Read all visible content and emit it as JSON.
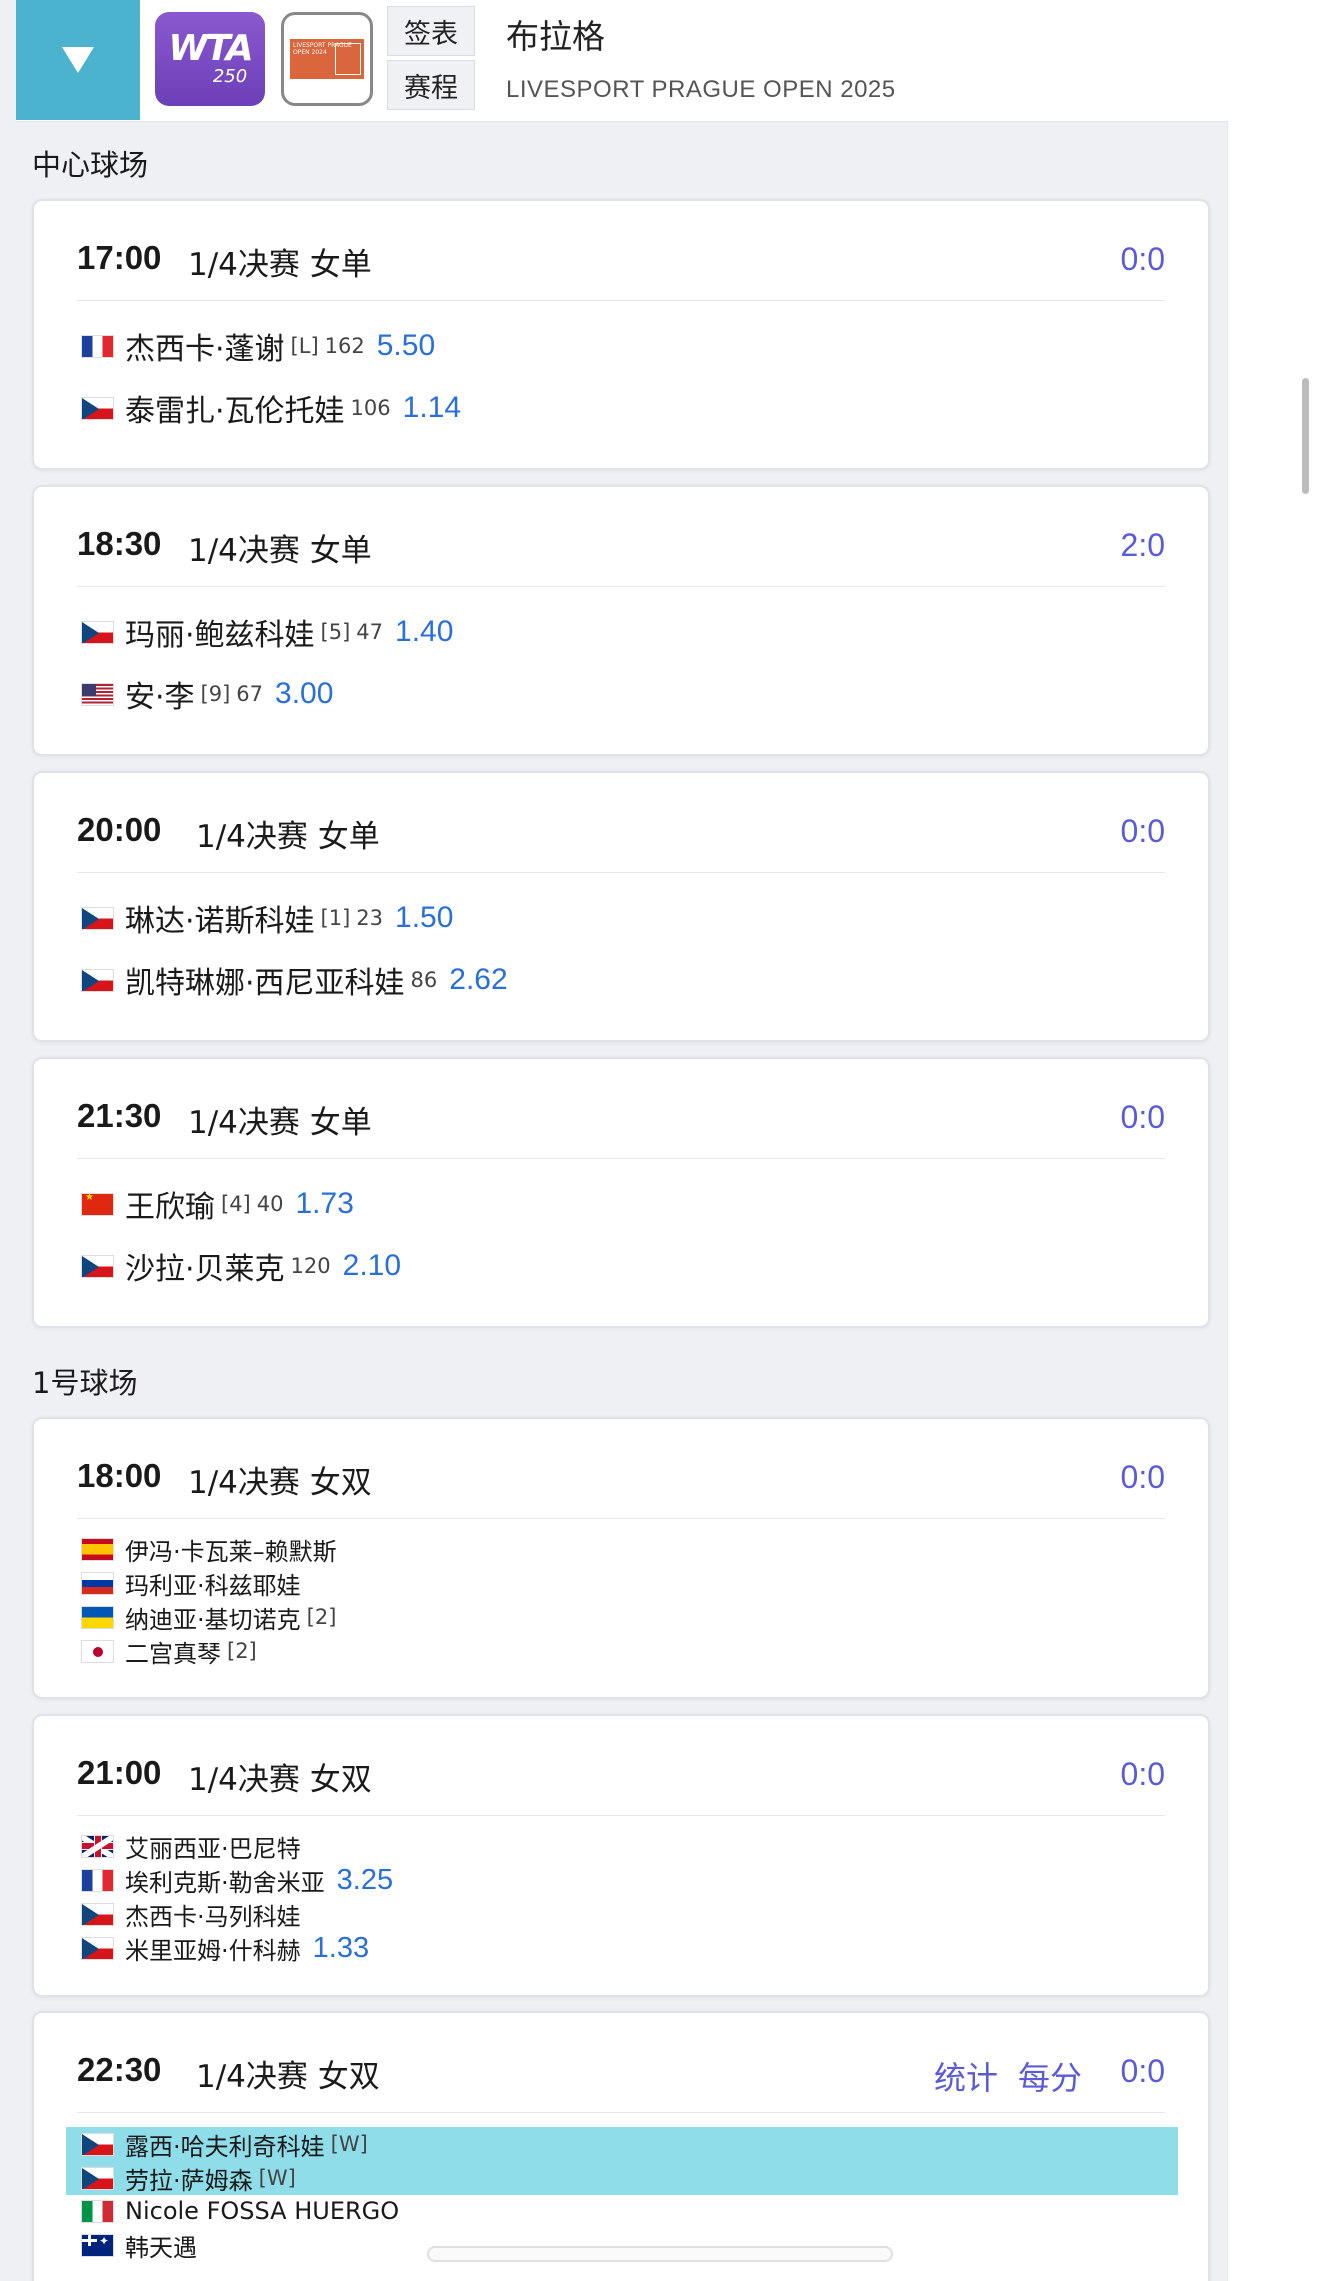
{
  "header": {
    "wta_brand": "WTA",
    "wta_tier": "250",
    "event_logo_text": "LIVESPORT PRAGUE OPEN 2024",
    "tab_draw": "签表",
    "tab_schedule": "赛程",
    "title": "布拉格",
    "subtitle": "LIVESPORT PRAGUE OPEN 2025"
  },
  "courts": [
    {
      "name": "中心球场",
      "matches": [
        {
          "time": "17:00",
          "round": "1/4决赛 女单",
          "score": "0:0",
          "players": [
            {
              "flag": "fr-flag-icon",
              "name": "杰西卡·蓬谢",
              "seed": "[L]",
              "rank": "162",
              "odds": "5.50"
            },
            {
              "flag": "cz-flag-icon",
              "name": "泰雷扎·瓦伦托娃",
              "seed": "",
              "rank": "106",
              "odds": "1.14"
            }
          ]
        },
        {
          "time": "18:30",
          "round": "1/4决赛 女单",
          "score": "2:0",
          "players": [
            {
              "flag": "cz-flag-icon",
              "name": "玛丽·鲍兹科娃",
              "seed": "[5]",
              "rank": "47",
              "odds": "1.40"
            },
            {
              "flag": "us-flag-icon",
              "name": "安·李",
              "seed": "[9]",
              "rank": "67",
              "odds": "3.00"
            }
          ]
        },
        {
          "time": "20:00",
          "round": "1/4决赛 女单",
          "score": "0:0",
          "players": [
            {
              "flag": "cz-flag-icon",
              "name": "琳达·诺斯科娃",
              "seed": "[1]",
              "rank": "23",
              "odds": "1.50"
            },
            {
              "flag": "cz-flag-icon",
              "name": "凯特琳娜·西尼亚科娃",
              "seed": "",
              "rank": "86",
              "odds": "2.62"
            }
          ]
        },
        {
          "time": "21:30",
          "round": "1/4决赛 女单",
          "score": "0:0",
          "players": [
            {
              "flag": "cn-flag-icon",
              "name": "王欣瑜",
              "seed": "[4]",
              "rank": "40",
              "odds": "1.73"
            },
            {
              "flag": "cz-flag-icon",
              "name": "沙拉·贝莱克",
              "seed": "",
              "rank": "120",
              "odds": "2.10"
            }
          ]
        }
      ]
    },
    {
      "name": "1号球场",
      "matches": [
        {
          "time": "18:00",
          "round": "1/4决赛 女双",
          "score": "0:0",
          "players": [
            {
              "flag": "es-flag-icon",
              "name": "伊冯·卡瓦莱–赖默斯",
              "seed": ""
            },
            {
              "flag": "ru-flag-icon",
              "name": "玛利亚·科兹耶娃",
              "seed": ""
            },
            {
              "flag": "ua-flag-icon",
              "name": "纳迪亚·基切诺克",
              "seed": "[2]"
            },
            {
              "flag": "jp-flag-icon",
              "name": "二宫真琴",
              "seed": "[2]"
            }
          ]
        },
        {
          "time": "21:00",
          "round": "1/4决赛 女双",
          "score": "0:0",
          "players": [
            {
              "flag": "gb-flag-icon",
              "name": "艾丽西亚·巴尼特",
              "seed": "",
              "odds": ""
            },
            {
              "flag": "fr-flag-icon",
              "name": "埃利克斯·勒舍米亚",
              "seed": "",
              "odds": "3.25"
            },
            {
              "flag": "cz-flag-icon",
              "name": "杰西卡·马列科娃",
              "seed": "",
              "odds": ""
            },
            {
              "flag": "cz-flag-icon",
              "name": "米里亚姆·什科赫",
              "seed": "",
              "odds": "1.33"
            }
          ]
        },
        {
          "time": "22:30",
          "round": "1/4决赛 女双",
          "score": "0:0",
          "link_stats": "统计",
          "link_points": "每分",
          "players": [
            {
              "flag": "cz-flag-icon",
              "name": "露西·哈夫利奇科娃",
              "seed": "[W]"
            },
            {
              "flag": "cz-flag-icon",
              "name": "劳拉·萨姆森",
              "seed": "[W]"
            },
            {
              "flag": "it-flag-icon",
              "name": "Nicole FOSSA HUERGO",
              "seed": ""
            },
            {
              "flag": "au-flag-icon",
              "name": "韩天遇",
              "seed": ""
            }
          ]
        }
      ]
    }
  ],
  "colors": {
    "accent": "#4bb3ce",
    "score": "#5b5bd6",
    "odds": "#2a6fd8",
    "highlight": "#8fdde9"
  }
}
